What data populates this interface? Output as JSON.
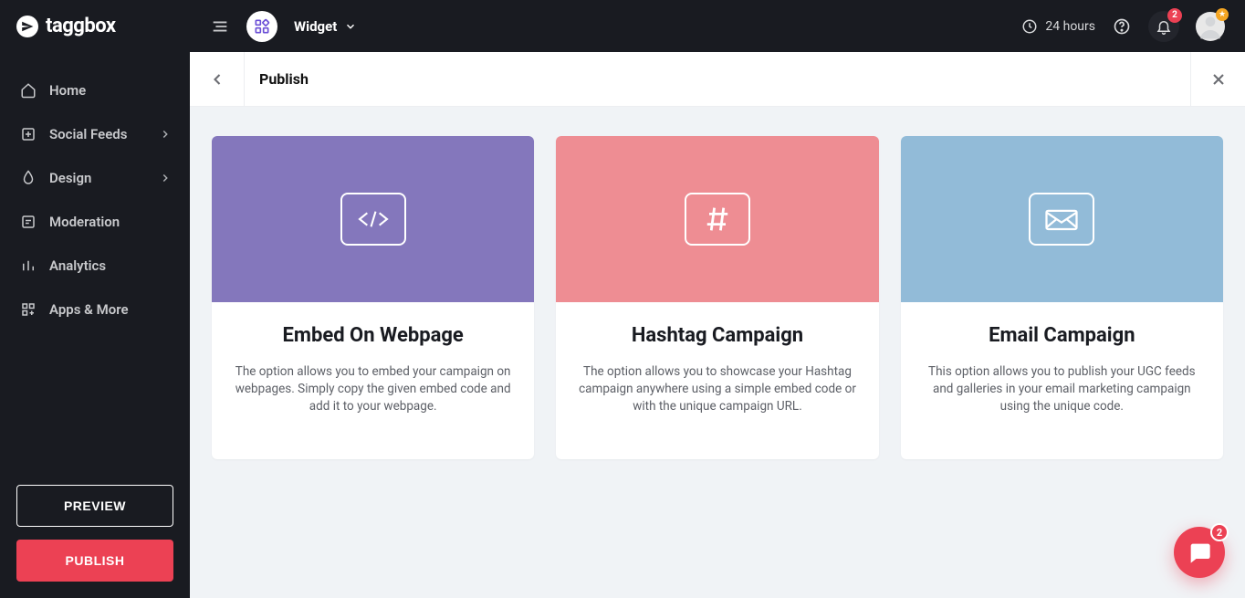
{
  "brand": "taggbox",
  "topbar": {
    "widget_label": "Widget",
    "time_chip": "24 hours",
    "notification_count": "2",
    "chat_count": "2"
  },
  "sidebar": {
    "items": [
      {
        "label": "Home",
        "icon": "home"
      },
      {
        "label": "Social Feeds",
        "icon": "feed",
        "chevron": true
      },
      {
        "label": "Design",
        "icon": "drop",
        "chevron": true
      },
      {
        "label": "Moderation",
        "icon": "moderation"
      },
      {
        "label": "Analytics",
        "icon": "analytics"
      },
      {
        "label": "Apps & More",
        "icon": "apps"
      }
    ],
    "preview_label": "PREVIEW",
    "publish_label": "PUBLISH"
  },
  "page": {
    "title": "Publish"
  },
  "cards": [
    {
      "title": "Embed On Webpage",
      "desc": "The option allows you to embed your campaign on webpages. Simply copy the given embed code and add it to your webpage.",
      "icon": "code"
    },
    {
      "title": "Hashtag Campaign",
      "desc": "The option allows you to showcase your Hashtag campaign anywhere using a simple embed code or with the unique campaign URL.",
      "icon": "hash"
    },
    {
      "title": "Email Campaign",
      "desc": "This option allows you to publish your UGC feeds and galleries in your email marketing campaign using the unique code.",
      "icon": "mail"
    }
  ]
}
